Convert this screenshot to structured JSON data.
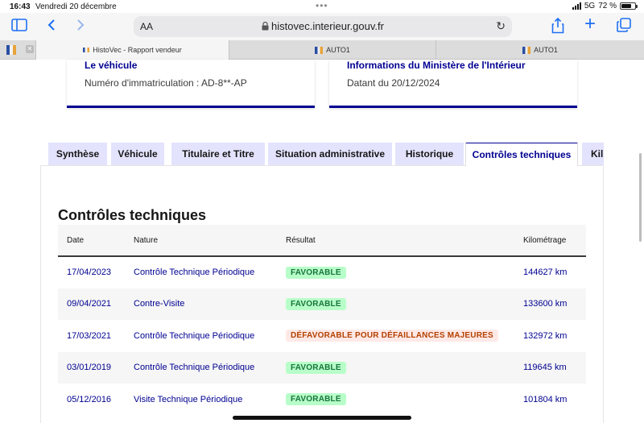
{
  "status": {
    "time": "16:43",
    "date": "Vendredi 20 décembre",
    "network": "5G",
    "battery": "72 %"
  },
  "browser": {
    "text_size_button": "AA",
    "url": "histovec.interieur.gouv.fr",
    "tabs": [
      {
        "label": "HistoVec - Rapport vendeur",
        "active": true
      },
      {
        "label": "AUTO1",
        "active": false
      },
      {
        "label": "AUTO1",
        "active": false
      }
    ]
  },
  "cards": {
    "vehicle": {
      "title": "Le véhicule",
      "text": "Numéro d'immatriculation : AD-8**-AP"
    },
    "ministry": {
      "title": "Informations du Ministère de l'Intérieur",
      "text": "Datant du 20/12/2024"
    }
  },
  "page_tabs": [
    {
      "label": "Synthèse",
      "active": false
    },
    {
      "label": "Véhicule",
      "active": false
    },
    {
      "label": "Titulaire et Titre",
      "active": false
    },
    {
      "label": "Situation administrative",
      "active": false
    },
    {
      "label": "Historique",
      "active": false
    },
    {
      "label": "Contrôles techniques",
      "active": true
    },
    {
      "label": "Kil",
      "active": false
    }
  ],
  "section": {
    "title": "Contrôles techniques",
    "columns": [
      "Date",
      "Nature",
      "Résultat",
      "Kilométrage"
    ],
    "rows": [
      {
        "date": "17/04/2023",
        "nature": "Contrôle Technique Périodique",
        "result": "FAVORABLE",
        "status": "ok",
        "km": "144627 km"
      },
      {
        "date": "09/04/2021",
        "nature": "Contre-Visite",
        "result": "FAVORABLE",
        "status": "ok",
        "km": "133600 km"
      },
      {
        "date": "17/03/2021",
        "nature": "Contrôle Technique Périodique",
        "result": "DÉFAVORABLE POUR DÉFAILLANCES MAJEURES",
        "status": "ko",
        "km": "132972 km"
      },
      {
        "date": "03/01/2019",
        "nature": "Contrôle Technique Périodique",
        "result": "FAVORABLE",
        "status": "ok",
        "km": "119645 km"
      },
      {
        "date": "05/12/2016",
        "nature": "Visite Technique Périodique",
        "result": "FAVORABLE",
        "status": "ok",
        "km": "101804 km"
      }
    ]
  },
  "colors": {
    "primary": "#000091",
    "favorable_bg": "#b8fec9",
    "favorable_fg": "#18753c",
    "unfavorable_bg": "#ffe9e6",
    "unfavorable_fg": "#b34000"
  }
}
